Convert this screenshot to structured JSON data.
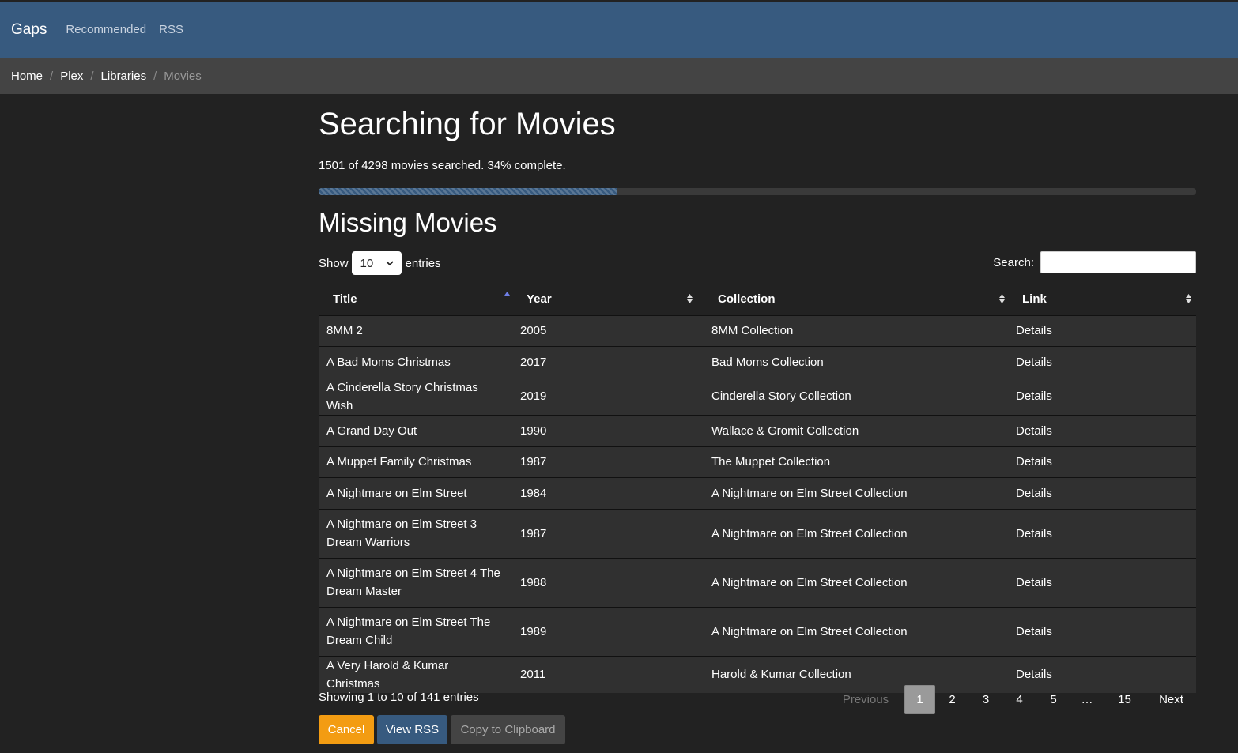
{
  "navbar": {
    "brand": "Gaps",
    "links": [
      "Recommended",
      "RSS"
    ]
  },
  "breadcrumb": [
    "Home",
    "Plex",
    "Libraries",
    "Movies"
  ],
  "page": {
    "title": "Searching for Movies",
    "progress_text": "1501 of 4298 movies searched. 34% complete.",
    "progress_fraction": 0.34,
    "section_title": "Missing Movies"
  },
  "table_controls": {
    "show_label": "Show",
    "entries_value": "10",
    "entries_label": "entries",
    "search_label": "Search:",
    "search_value": ""
  },
  "table": {
    "columns": [
      "Title",
      "Year",
      "Collection",
      "Link"
    ],
    "rows": [
      {
        "title": "8MM 2",
        "year": "2005",
        "collection": "8MM Collection",
        "link": "Details"
      },
      {
        "title": "A Bad Moms Christmas",
        "year": "2017",
        "collection": "Bad Moms Collection",
        "link": "Details"
      },
      {
        "title": "A Cinderella Story Christmas Wish",
        "year": "2019",
        "collection": "Cinderella Story Collection",
        "link": "Details"
      },
      {
        "title": "A Grand Day Out",
        "year": "1990",
        "collection": "Wallace & Gromit Collection",
        "link": "Details"
      },
      {
        "title": "A Muppet Family Christmas",
        "year": "1987",
        "collection": "The Muppet Collection",
        "link": "Details"
      },
      {
        "title": "A Nightmare on Elm Street",
        "year": "1984",
        "collection": "A Nightmare on Elm Street Collection",
        "link": "Details"
      },
      {
        "title": "A Nightmare on Elm Street 3 Dream Warriors",
        "year": "1987",
        "collection": "A Nightmare on Elm Street Collection",
        "link": "Details"
      },
      {
        "title": "A Nightmare on Elm Street 4 The Dream Master",
        "year": "1988",
        "collection": "A Nightmare on Elm Street Collection",
        "link": "Details"
      },
      {
        "title": "A Nightmare on Elm Street The Dream Child",
        "year": "1989",
        "collection": "A Nightmare on Elm Street Collection",
        "link": "Details"
      },
      {
        "title": "A Very Harold & Kumar Christmas",
        "year": "2011",
        "collection": "Harold & Kumar Collection",
        "link": "Details"
      }
    ]
  },
  "info": "Showing 1 to 10 of 141 entries",
  "pagination": {
    "previous": "Previous",
    "pages": [
      "1",
      "2",
      "3",
      "4",
      "5"
    ],
    "ellipsis": "…",
    "last": "15",
    "next": "Next",
    "current": "1"
  },
  "buttons": {
    "cancel": "Cancel",
    "view_rss": "View RSS",
    "copy": "Copy to Clipboard"
  },
  "colors": {
    "navbar": "#375a7f",
    "link": "#00bc8c",
    "cancel": "#f39c12",
    "background": "#222222"
  }
}
